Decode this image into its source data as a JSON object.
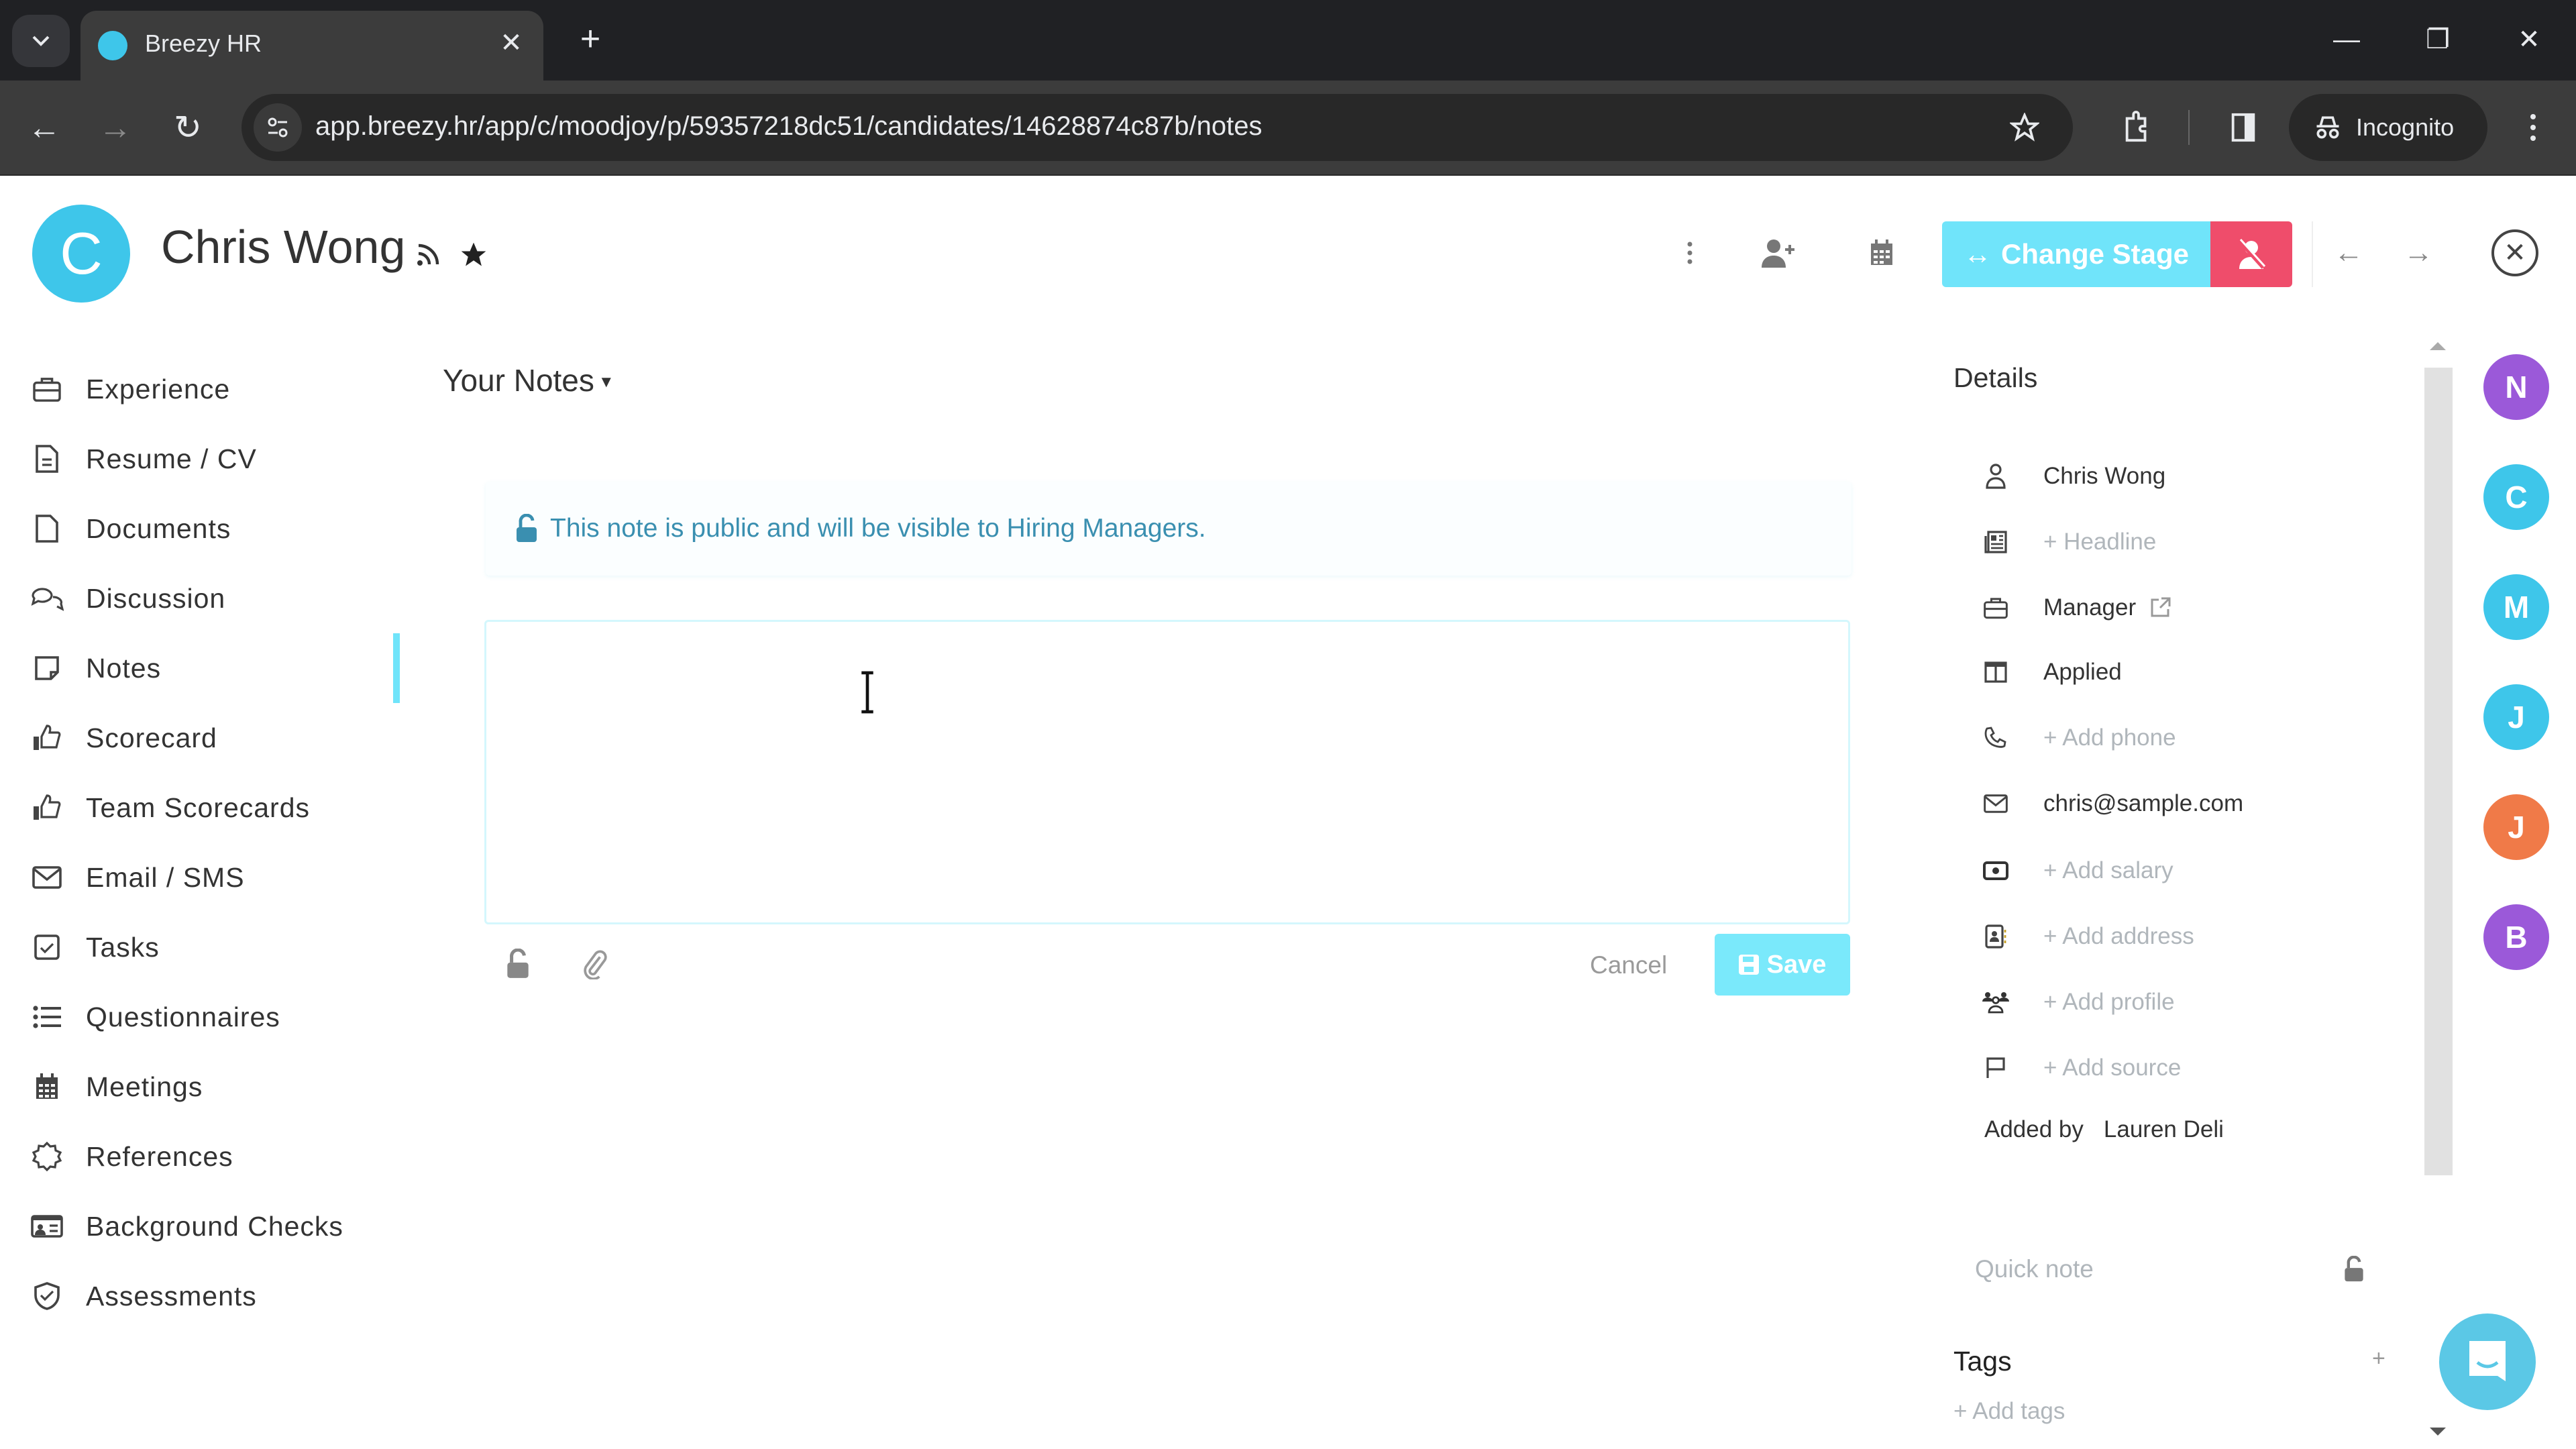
{
  "browser": {
    "tab_title": "Breezy HR",
    "url": "app.breezy.hr/app/c/moodjoy/p/59357218dc51/candidates/14628874c87b/notes",
    "incognito_label": "Incognito",
    "new_tab_symbol": "+",
    "close_tab_symbol": "✕",
    "window_controls": {
      "minimize": "—",
      "restore": "❐",
      "close": "✕"
    },
    "nav": {
      "back": "←",
      "forward": "→",
      "reload": "↻"
    }
  },
  "candidate": {
    "initial": "C",
    "name": "Chris Wong",
    "avatar_color": "#3ec6ea"
  },
  "header_actions": {
    "change_stage_label": "Change Stage",
    "change_stage_icon": "↔",
    "change_stage_color": "#70e4fa",
    "disqualify_color": "#ef4d6b",
    "prev_symbol": "←",
    "next_symbol": "→",
    "close_symbol": "✕"
  },
  "sidebar": {
    "active": "Notes",
    "accent_color": "#70e4fa",
    "items": [
      {
        "label": "Experience",
        "icon": "briefcase-icon"
      },
      {
        "label": "Resume / CV",
        "icon": "file-text-icon"
      },
      {
        "label": "Documents",
        "icon": "document-icon"
      },
      {
        "label": "Discussion",
        "icon": "chat-bubbles-icon"
      },
      {
        "label": "Notes",
        "icon": "sticky-note-icon"
      },
      {
        "label": "Scorecard",
        "icon": "thumbs-up-icon"
      },
      {
        "label": "Team Scorecards",
        "icon": "thumbs-up-icon"
      },
      {
        "label": "Email / SMS",
        "icon": "envelope-icon"
      },
      {
        "label": "Tasks",
        "icon": "checkbox-icon"
      },
      {
        "label": "Questionnaires",
        "icon": "list-icon"
      },
      {
        "label": "Meetings",
        "icon": "calendar-icon"
      },
      {
        "label": "References",
        "icon": "badge-icon"
      },
      {
        "label": "Background Checks",
        "icon": "id-card-icon"
      },
      {
        "label": "Assessments",
        "icon": "shield-check-icon"
      }
    ]
  },
  "notes": {
    "section_title": "Your Notes",
    "visibility_message": "This note is public and will be visible to Hiring Managers.",
    "editor_value": "",
    "cancel_label": "Cancel",
    "save_label": "Save",
    "save_color": "#7ae9fb",
    "message_color": "#3a8fb0"
  },
  "details": {
    "title": "Details",
    "rows": [
      {
        "icon": "person-icon",
        "value": "Chris Wong",
        "placeholder": false
      },
      {
        "icon": "newspaper-icon",
        "value": "+ Headline",
        "placeholder": true
      },
      {
        "icon": "briefcase-icon",
        "value": "Manager",
        "placeholder": false,
        "external_link": true
      },
      {
        "icon": "columns-icon",
        "value": "Applied",
        "placeholder": false
      },
      {
        "icon": "phone-icon",
        "value": "+ Add phone",
        "placeholder": true
      },
      {
        "icon": "envelope-icon",
        "value": "chris@sample.com",
        "placeholder": false
      },
      {
        "icon": "money-icon",
        "value": "+ Add salary",
        "placeholder": true
      },
      {
        "icon": "contact-book-icon",
        "value": "+ Add address",
        "placeholder": true
      },
      {
        "icon": "people-icon",
        "value": "+ Add profile",
        "placeholder": true
      },
      {
        "icon": "flag-icon",
        "value": "+ Add source",
        "placeholder": true
      }
    ],
    "added_by_label": "Added by",
    "added_by_name": "Lauren Deli",
    "quick_note_placeholder": "Quick note",
    "tags_title": "Tags",
    "tags_add_symbol": "+",
    "add_tags_label": "+ Add tags"
  },
  "team_avatars": [
    {
      "initial": "N",
      "color": "#9b59d9"
    },
    {
      "initial": "C",
      "color": "#3ec6ea"
    },
    {
      "initial": "M",
      "color": "#3ec6ea"
    },
    {
      "initial": "J",
      "color": "#3ec6ea"
    },
    {
      "initial": "J",
      "color": "#f07a48"
    },
    {
      "initial": "B",
      "color": "#9b59d9"
    }
  ]
}
